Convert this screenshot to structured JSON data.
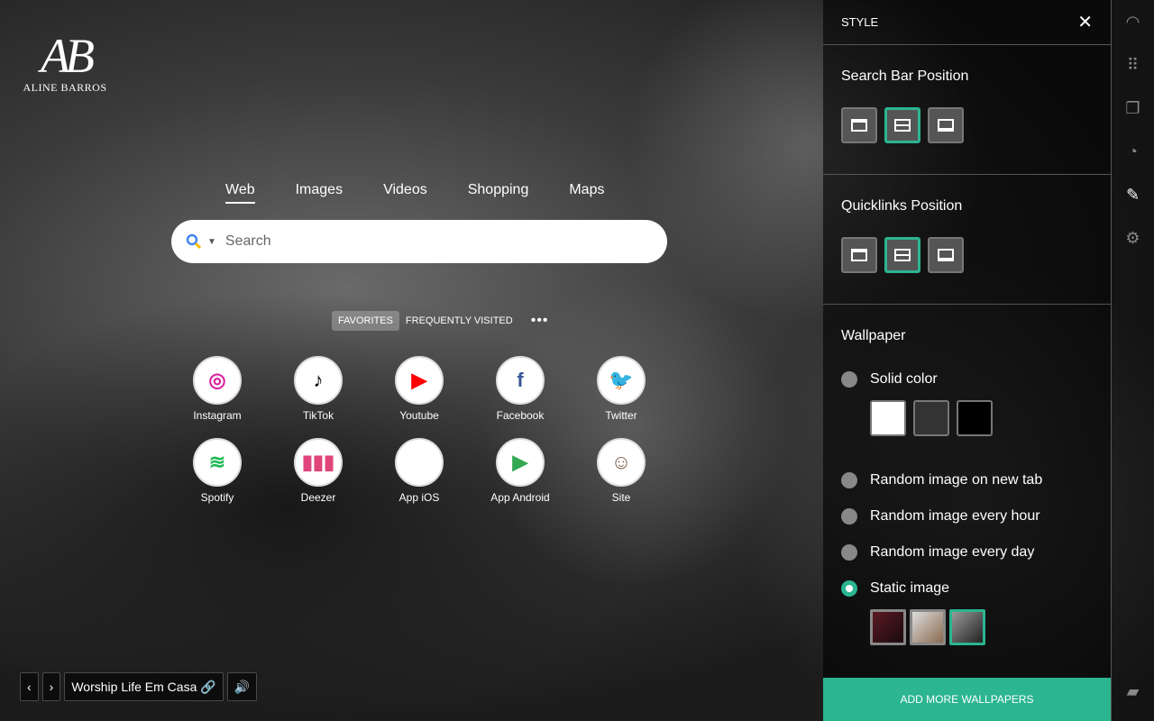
{
  "logo": {
    "mark": "AB",
    "name": "ALINE BARROS"
  },
  "search": {
    "tabs": [
      "Web",
      "Images",
      "Videos",
      "Shopping",
      "Maps"
    ],
    "active_tab": "Web",
    "placeholder": "Search"
  },
  "quicklinks": {
    "tabs": [
      "FAVORITES",
      "FREQUENTLY VISITED"
    ],
    "active": "FAVORITES",
    "items": [
      {
        "label": "Instagram",
        "glyph": "◎",
        "color": "#d6249f"
      },
      {
        "label": "TikTok",
        "glyph": "♪",
        "color": "#000000"
      },
      {
        "label": "Youtube",
        "glyph": "▶",
        "color": "#ff0000"
      },
      {
        "label": "Facebook",
        "glyph": "f",
        "color": "#3b5998"
      },
      {
        "label": "Twitter",
        "glyph": "🐦",
        "color": "#1da1f2"
      },
      {
        "label": "Spotify",
        "glyph": "≋",
        "color": "#1db954"
      },
      {
        "label": "Deezer",
        "glyph": "▮▮▮",
        "color": "#e0457b"
      },
      {
        "label": "App iOS",
        "glyph": "",
        "color": "#000000"
      },
      {
        "label": "App Android",
        "glyph": "▶",
        "color": "#34a853"
      },
      {
        "label": "Site",
        "glyph": "☺",
        "color": "#7a5a44"
      }
    ]
  },
  "player": {
    "title": "Worship Life Em Casa"
  },
  "panel": {
    "title": "STYLE",
    "search_bar_position": "Search Bar Position",
    "quicklinks_position": "Quicklinks Position",
    "wallpaper": "Wallpaper",
    "options": [
      "Solid color",
      "Random image on new tab",
      "Random image every hour",
      "Random image every day",
      "Static image"
    ],
    "selected_option": "Static image",
    "add_button": "ADD MORE WALLPAPERS",
    "colors": [
      "#ffffff",
      "#333333",
      "#000000"
    ],
    "accent": "#2bb591"
  }
}
